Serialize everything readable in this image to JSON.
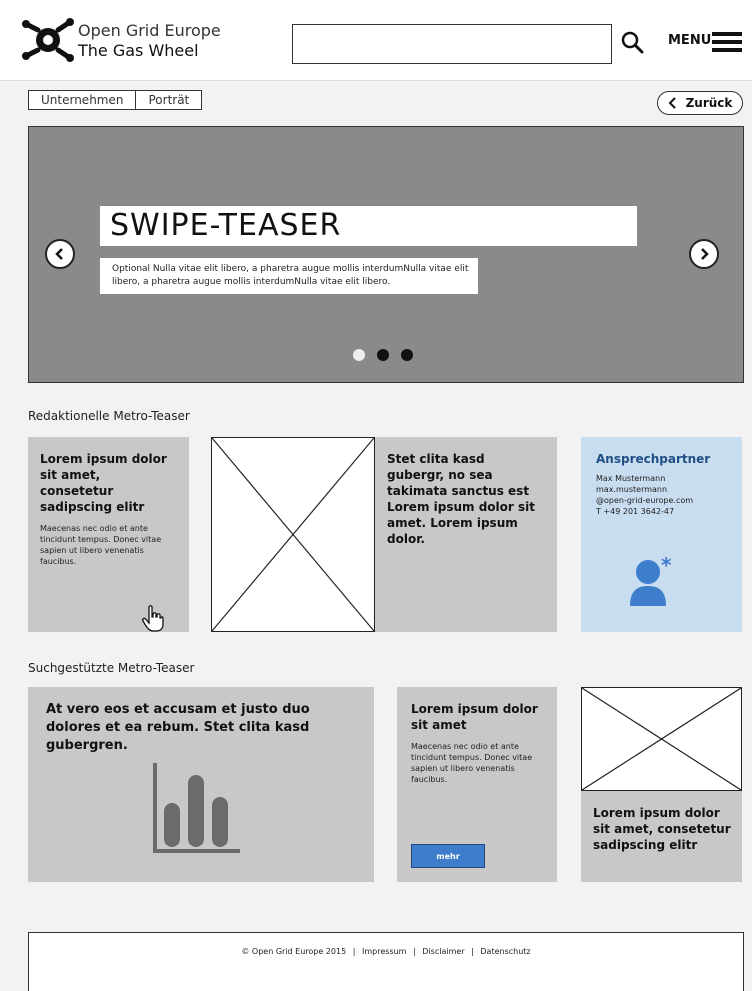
{
  "header": {
    "brand_line1": "Open Grid Europe",
    "brand_line2": "The Gas Wheel",
    "search_value": "",
    "menu_label": "MENU"
  },
  "breadcrumb": [
    "Unternehmen",
    "Porträt"
  ],
  "back_label": "Zurück",
  "hero": {
    "title": "SWIPE-TEASER",
    "text": "Optional Nulla vitae elit libero, a pharetra augue mollis interdumNulla vitae elit libero, a pharetra augue mollis interdumNulla vitae elit libero.",
    "active_slide": 1,
    "slide_count": 3
  },
  "sections": {
    "editorial_title": "Redaktionelle Metro-Teaser",
    "search_title": "Suchgestützte Metro-Teaser"
  },
  "editorial": {
    "tile1_heading": "Lorem ipsum dolor sit amet, consetetur sadipscing elitr",
    "tile1_body": "Maecenas nec odio et ante tincidunt tempus. Donec vitae sapien ut libero venenatis faucibus.",
    "tile3_heading": "Stet clita kasd gubergr, no sea takimata sanctus est Lorem ipsum dolor sit amet. Lorem ipsum dolor.",
    "contact_heading": "Ansprechpartner",
    "contact_name": "Max Mustermann",
    "contact_email_1": "max.mustermann",
    "contact_email_2": "@open-grid-europe.com",
    "contact_phone": "T +49 201 3642-47"
  },
  "search_tiles": {
    "tile1_heading": "At vero eos et accusam et justo duo dolores et ea rebum. Stet clita kasd gubergren.",
    "tile2_heading": "Lorem ipsum dolor sit amet",
    "tile2_body": "Maecenas nec odio et ante tincidunt tempus. Donec vitae sapien ut libero venenatis faucibus.",
    "mehr_label": "mehr",
    "tile3_heading": "Lorem ipsum dolor sit amet, consetetur sadipscing elitr"
  },
  "footer": {
    "copyright": "© Open Grid Europe 2015",
    "sep": "|",
    "links": [
      "Impressum",
      "Disclaimer",
      "Datenschutz"
    ]
  },
  "colors": {
    "hero_bg": "#8a8a8a",
    "tile_bg": "#c8c8c8",
    "contact_bg": "#c9ddf0",
    "accent_blue": "#3e7ccc",
    "contact_heading": "#1f4e86"
  }
}
